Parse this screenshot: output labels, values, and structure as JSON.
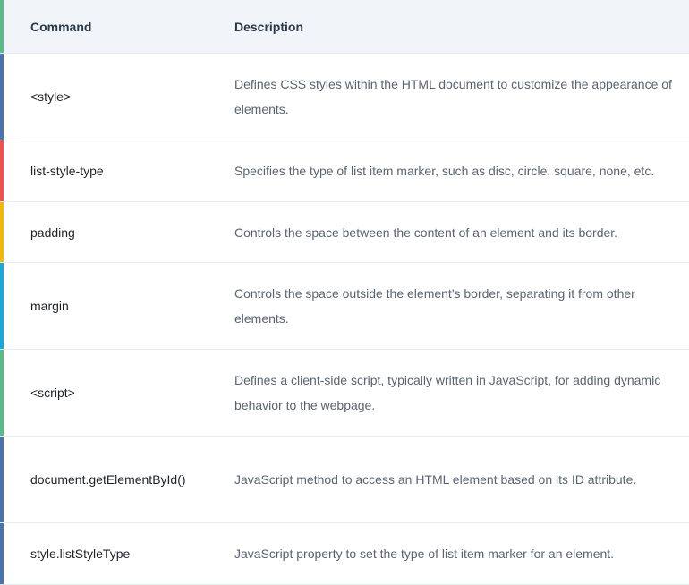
{
  "header": {
    "command": "Command",
    "description": "Description"
  },
  "colors": {
    "header_bg": "#f1f5f9",
    "accents": [
      "#5cb98a",
      "#4a74a8",
      "#f05050",
      "#f5b60a",
      "#1aa8d8",
      "#5cb98a",
      "#4a74a8",
      "#4a74a8"
    ]
  },
  "rows": [
    {
      "command": "<style>",
      "description": "Defines CSS styles within the HTML document to customize the appearance of elements."
    },
    {
      "command": "list-style-type",
      "description": "Specifies the type of list item marker, such as disc, circle, square, none, etc."
    },
    {
      "command": "padding",
      "description": "Controls the space between the content of an element and its border."
    },
    {
      "command": "margin",
      "description": "Controls the space outside the element's border, separating it from other elements."
    },
    {
      "command": "<script>",
      "description": "Defines a client-side script, typically written in JavaScript, for adding dynamic behavior to the webpage."
    },
    {
      "command": "document.getElementById()",
      "description": "JavaScript method to access an HTML element based on its ID attribute."
    },
    {
      "command": "style.listStyleType",
      "description": "JavaScript property to set the type of list item marker for an element."
    }
  ]
}
